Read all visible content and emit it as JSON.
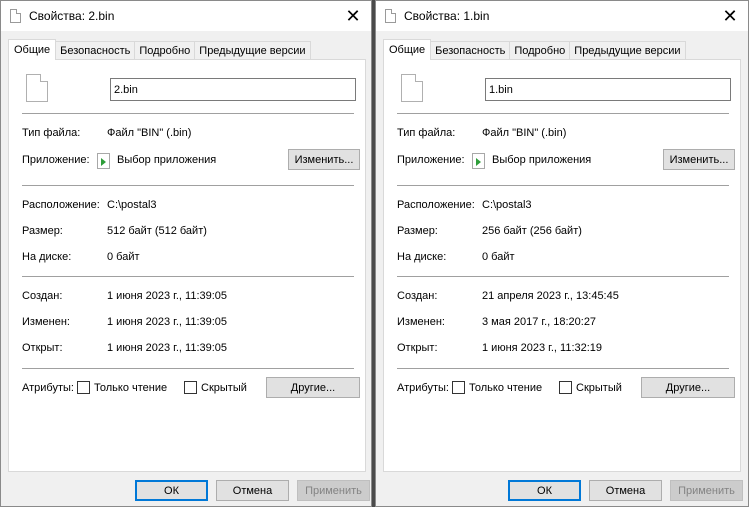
{
  "windows": [
    {
      "title": "Свойства: 2.bin",
      "tabs": [
        "Общие",
        "Безопасность",
        "Подробно",
        "Предыдущие версии"
      ],
      "active_tab": "Общие",
      "file_name": "2.bin",
      "labels": {
        "type": "Тип файла:",
        "app": "Приложение:",
        "location": "Расположение:",
        "size": "Размер:",
        "disk": "На диске:",
        "created": "Создан:",
        "modified": "Изменен:",
        "opened": "Открыт:",
        "attributes": "Атрибуты:"
      },
      "values": {
        "type": "Файл \"BIN\" (.bin)",
        "app": "Выбор приложения",
        "location": "C:\\postal3",
        "size": "512 байт (512 байт)",
        "disk": "0 байт",
        "created": "1 июня 2023 г., 11:39:05",
        "modified": "1 июня 2023 г., 11:39:05",
        "opened": "1 июня 2023 г., 11:39:05"
      },
      "change_button": "Изменить...",
      "readonly_label": "Только чтение",
      "hidden_label": "Скрытый",
      "other_button": "Другие...",
      "ok_button": "ОК",
      "cancel_button": "Отмена",
      "apply_button": "Применить"
    },
    {
      "title": "Свойства: 1.bin",
      "tabs": [
        "Общие",
        "Безопасность",
        "Подробно",
        "Предыдущие версии"
      ],
      "active_tab": "Общие",
      "file_name": "1.bin",
      "labels": {
        "type": "Тип файла:",
        "app": "Приложение:",
        "location": "Расположение:",
        "size": "Размер:",
        "disk": "На диске:",
        "created": "Создан:",
        "modified": "Изменен:",
        "opened": "Открыт:",
        "attributes": "Атрибуты:"
      },
      "values": {
        "type": "Файл \"BIN\" (.bin)",
        "app": "Выбор приложения",
        "location": "C:\\postal3",
        "size": "256 байт (256 байт)",
        "disk": "0 байт",
        "created": "21 апреля 2023 г., 13:45:45",
        "modified": "3 мая 2017 г., 18:20:27",
        "opened": "1 июня 2023 г., 11:32:19"
      },
      "change_button": "Изменить...",
      "readonly_label": "Только чтение",
      "hidden_label": "Скрытый",
      "other_button": "Другие...",
      "ok_button": "ОК",
      "cancel_button": "Отмена",
      "apply_button": "Применить"
    }
  ]
}
